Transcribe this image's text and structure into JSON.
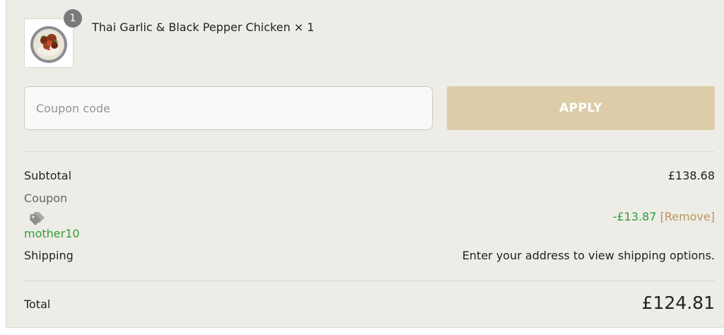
{
  "colors": {
    "panel_bg": "#eeece6",
    "apply_bg": "#dccda8",
    "discount_green": "#2e9e3c",
    "remove_gold": "#b9975b"
  },
  "cart_item": {
    "quantity_badge": "1",
    "name": "Thai Garlic & Black Pepper Chicken × 1",
    "image_icon": "food-bowl-image"
  },
  "coupon": {
    "placeholder": "Coupon code",
    "value": "",
    "apply_label": "APPLY"
  },
  "summary": {
    "subtotal_label": "Subtotal",
    "subtotal_value": "£138.68",
    "coupon_label": "Coupon",
    "coupon_icon": "tag-icon",
    "coupon_code": "mother10",
    "coupon_discount": "-£13.87",
    "remove_label": "[Remove]",
    "shipping_label": "Shipping",
    "shipping_value": "Enter your address to view shipping options.",
    "total_label": "Total",
    "total_value": "£124.81"
  }
}
